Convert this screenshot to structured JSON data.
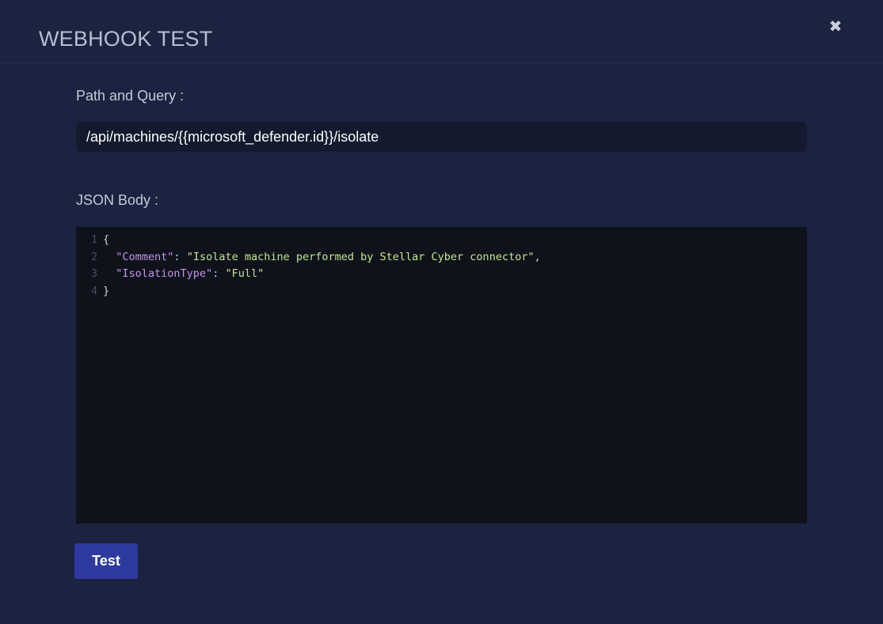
{
  "modal": {
    "title": "WEBHOOK TEST",
    "close_icon": "close-icon"
  },
  "path_query": {
    "label": "Path and Query :",
    "value": "/api/machines/{{microsoft_defender.id}}/isolate"
  },
  "json_body": {
    "label": "JSON Body :",
    "lines": [
      {
        "number": "1",
        "brace": "{"
      },
      {
        "number": "2",
        "key": "\"Comment\"",
        "colon": ": ",
        "value": "\"Isolate machine performed by Stellar Cyber connector\"",
        "trail": ","
      },
      {
        "number": "3",
        "key": "\"IsolationType\"",
        "colon": ": ",
        "value": "\"Full\"",
        "trail": ""
      },
      {
        "number": "4",
        "brace": "}"
      }
    ]
  },
  "actions": {
    "test_label": "Test"
  }
}
